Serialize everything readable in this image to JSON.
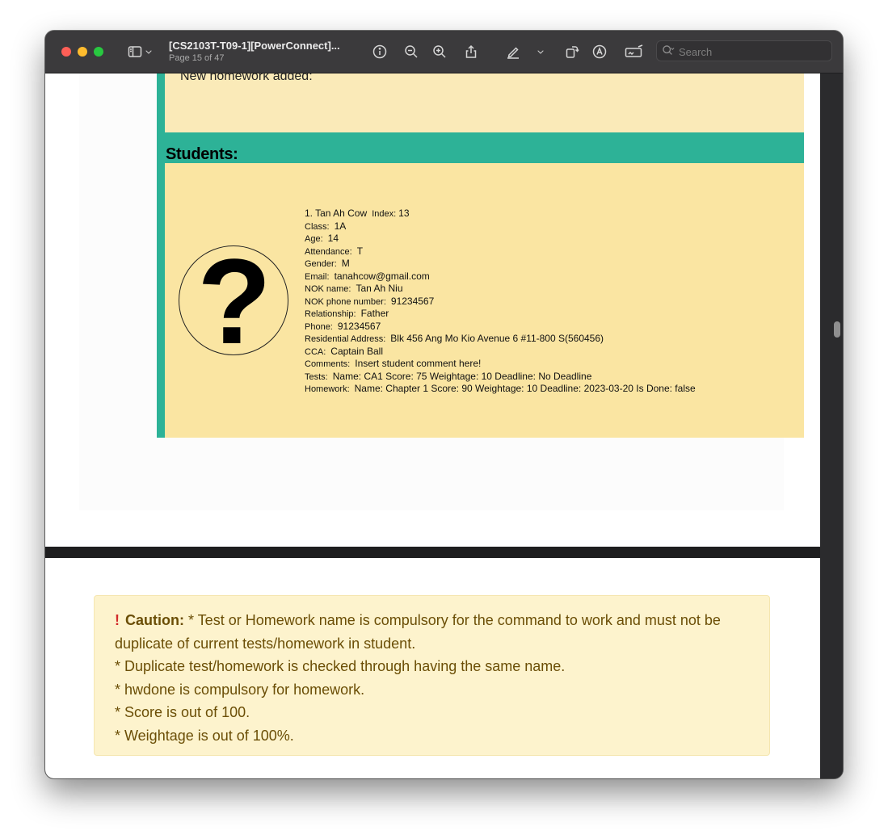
{
  "window": {
    "title": "[CS2103T-T09-1][PowerConnect]...",
    "subtitle": "Page 15 of 47",
    "search_placeholder": "Search"
  },
  "toolbar": {
    "icons": [
      "sidebar-icon",
      "chevron-down-icon",
      "info-icon",
      "zoom-out-icon",
      "zoom-in-icon",
      "share-icon",
      "markup-icon",
      "chevron-down-icon",
      "rotate-icon",
      "annotate-icon",
      "signature-icon",
      "search-icon"
    ]
  },
  "page1": {
    "top_line": "New homework added:",
    "banner": "Students:",
    "student": {
      "number": "1.",
      "name": "Tan Ah Cow",
      "index_label": "Index:",
      "index": "13",
      "rows": [
        {
          "label": "Class:",
          "value": "1A"
        },
        {
          "label": "Age:",
          "value": "14"
        },
        {
          "label": "Attendance:",
          "value": "T"
        },
        {
          "label": "Gender:",
          "value": "M"
        },
        {
          "label": "Email:",
          "value": "tanahcow@gmail.com"
        },
        {
          "label": "NOK name:",
          "value": "Tan Ah Niu"
        },
        {
          "label": "NOK phone number:",
          "value": "91234567"
        },
        {
          "label": "Relationship:",
          "value": "Father"
        },
        {
          "label": "Phone:",
          "value": "91234567"
        },
        {
          "label": "Residential Address:",
          "value": "Blk 456 Ang Mo Kio Avenue 6 #11-800 S(560456)"
        },
        {
          "label": "CCA:",
          "value": "Captain Ball"
        },
        {
          "label": "Comments:",
          "value": "Insert student comment here!"
        },
        {
          "label": "Tests:",
          "value": "Name: CA1 Score: 75 Weightage: 10 Deadline: No Deadline"
        },
        {
          "label": "Homework:",
          "value": "Name: Chapter 1 Score: 90 Weightage: 10 Deadline: 2023-03-20 Is Done: false"
        }
      ]
    }
  },
  "caution": {
    "icon": "!",
    "label": "Caution:",
    "line1_rest": "* Test or Homework name is compulsory for the command to work and must not be duplicate of current tests/homework in student.",
    "lines": [
      "* Duplicate test/homework is checked through having the same name.",
      "* hwdone is compulsory for homework.",
      "* Score is out of 100.",
      "* Weightage is out of 100%."
    ]
  }
}
